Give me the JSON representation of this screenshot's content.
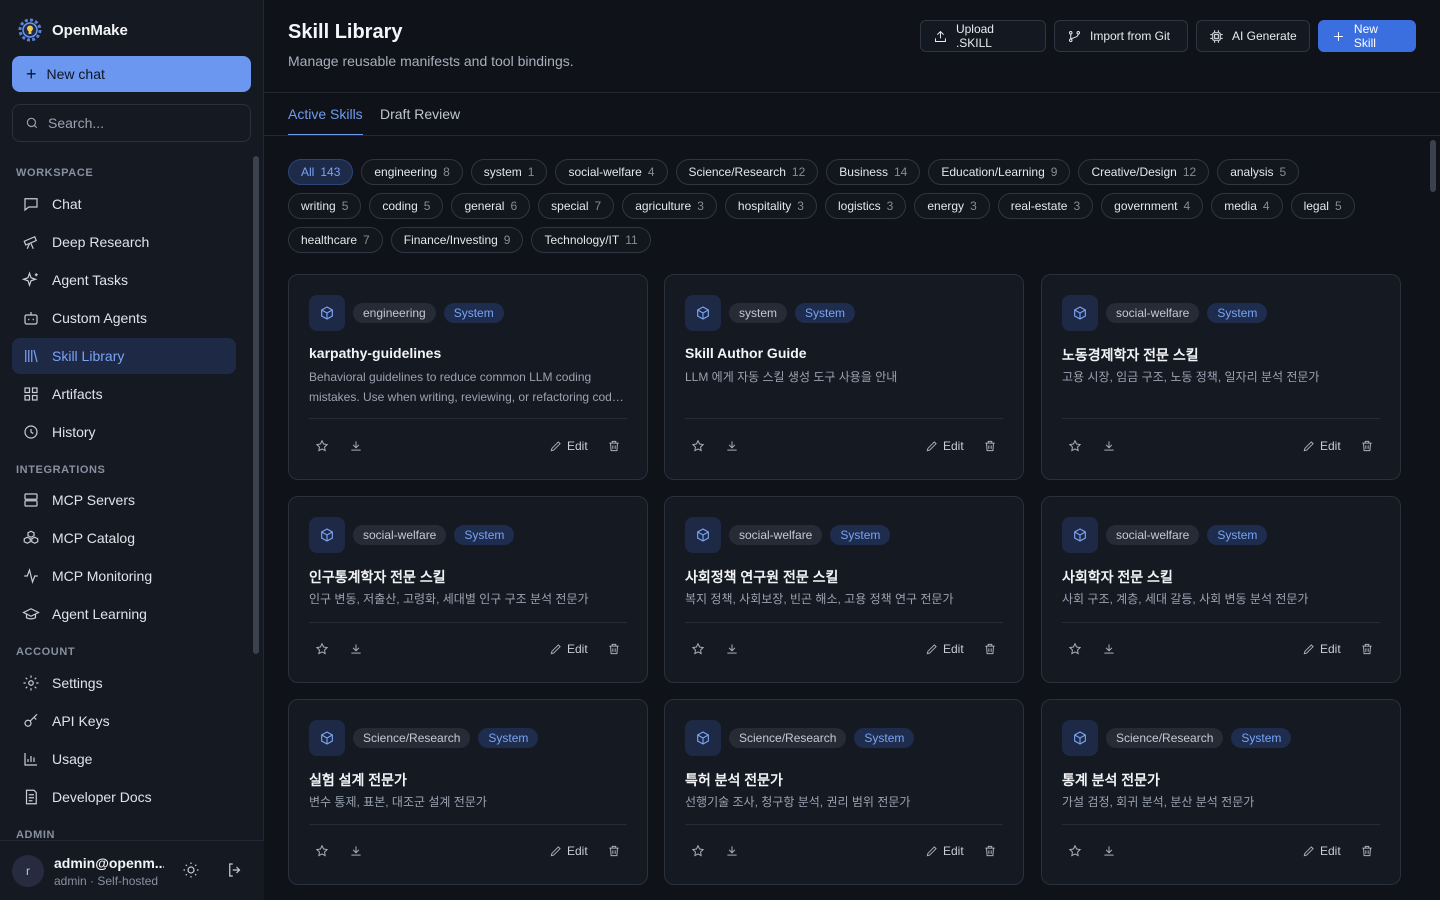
{
  "app": {
    "name": "OpenMake"
  },
  "sidebar": {
    "new_chat": "New chat",
    "search_placeholder": "Search...",
    "sections": {
      "workspace": "WORKSPACE",
      "integrations": "INTEGRATIONS",
      "account": "ACCOUNT",
      "admin": "ADMIN"
    },
    "items": [
      {
        "label": "Chat",
        "icon": "chat-icon"
      },
      {
        "label": "Deep Research",
        "icon": "telescope-icon"
      },
      {
        "label": "Agent Tasks",
        "icon": "sparkles-icon"
      },
      {
        "label": "Custom Agents",
        "icon": "bot-icon"
      },
      {
        "label": "Skill Library",
        "icon": "library-icon",
        "active": true
      },
      {
        "label": "Artifacts",
        "icon": "grid-icon"
      },
      {
        "label": "History",
        "icon": "clock-icon"
      },
      {
        "label": "MCP Servers",
        "icon": "server-icon"
      },
      {
        "label": "MCP Catalog",
        "icon": "boxes-icon"
      },
      {
        "label": "MCP Monitoring",
        "icon": "activity-icon"
      },
      {
        "label": "Agent Learning",
        "icon": "graduation-cap-icon"
      },
      {
        "label": "Settings",
        "icon": "gear-icon"
      },
      {
        "label": "API Keys",
        "icon": "key-icon"
      },
      {
        "label": "Usage",
        "icon": "bar-chart-icon"
      },
      {
        "label": "Developer Docs",
        "icon": "docs-icon"
      }
    ],
    "user": {
      "avatar": "r",
      "name": "admin@openm...",
      "role": "admin · Self-hosted"
    }
  },
  "header": {
    "title": "Skill Library",
    "subtitle": "Manage reusable manifests and tool bindings.",
    "buttons": {
      "upload": "Upload .SKILL",
      "import": "Import from Git",
      "ai": "AI Generate",
      "new": "New Skill"
    }
  },
  "tabs": [
    "Active Skills",
    "Draft Review"
  ],
  "chips": [
    [
      [
        "All",
        "143"
      ],
      [
        "engineering",
        "8"
      ],
      [
        "system",
        "1"
      ],
      [
        "social-welfare",
        "4"
      ],
      [
        "Science/Research",
        "12"
      ],
      [
        "Business",
        "14"
      ],
      [
        "Education/Learning",
        "9"
      ],
      [
        "Creative/Design",
        "12"
      ],
      [
        "analysis",
        "5"
      ]
    ],
    [
      [
        "writing",
        "5"
      ],
      [
        "coding",
        "5"
      ],
      [
        "general",
        "6"
      ],
      [
        "special",
        "7"
      ],
      [
        "agriculture",
        "3"
      ],
      [
        "hospitality",
        "3"
      ],
      [
        "logistics",
        "3"
      ],
      [
        "energy",
        "3"
      ],
      [
        "real-estate",
        "3"
      ],
      [
        "government",
        "4"
      ],
      [
        "media",
        "4"
      ],
      [
        "legal",
        "5"
      ]
    ],
    [
      [
        "healthcare",
        "7"
      ],
      [
        "Finance/Investing",
        "9"
      ],
      [
        "Technology/IT",
        "11"
      ]
    ]
  ],
  "system_tag": "System",
  "edit_label": "Edit",
  "cards": [
    {
      "category": "engineering",
      "title": "karpathy-guidelines",
      "desc": "Behavioral guidelines to reduce common LLM coding mistakes. Use when writing, reviewing, or refactoring code to avoid overcomplication."
    },
    {
      "category": "system",
      "title": "Skill Author Guide",
      "desc": "LLM 에게 자동 스킬 생성 도구 사용을 안내"
    },
    {
      "category": "social-welfare",
      "title": "노동경제학자 전문 스킬",
      "desc": "고용 시장, 임금 구조, 노동 정책, 일자리 분석 전문가"
    },
    {
      "category": "social-welfare",
      "title": "인구통계학자 전문 스킬",
      "desc": "인구 변동, 저출산, 고령화, 세대별 인구 구조 분석 전문가"
    },
    {
      "category": "social-welfare",
      "title": "사회정책 연구원 전문 스킬",
      "desc": "복지 정책, 사회보장, 빈곤 해소, 고용 정책 연구 전문가"
    },
    {
      "category": "social-welfare",
      "title": "사회학자 전문 스킬",
      "desc": "사회 구조, 계층, 세대 갈등, 사회 변동 분석 전문가"
    },
    {
      "category": "Science/Research",
      "title": "실험 설계 전문가",
      "desc": "변수 통제, 표본, 대조군 설계 전문가"
    },
    {
      "category": "Science/Research",
      "title": "특허 분석 전문가",
      "desc": "선행기술 조사, 청구항 분석, 권리 범위 전문가"
    },
    {
      "category": "Science/Research",
      "title": "통계 분석 전문가",
      "desc": "가설 검정, 회귀 분석, 분산 분석 전문가"
    }
  ]
}
